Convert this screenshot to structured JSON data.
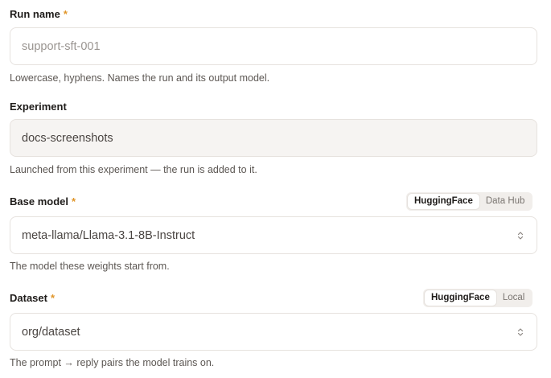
{
  "run_name": {
    "label": "Run name",
    "required_mark": "*",
    "placeholder": "support-sft-001",
    "value": "",
    "help": "Lowercase, hyphens. Names the run and its output model."
  },
  "experiment": {
    "label": "Experiment",
    "value": "docs-screenshots",
    "help": "Launched from this experiment — the run is added to it."
  },
  "base_model": {
    "label": "Base model",
    "required_mark": "*",
    "value": "meta-llama/Llama-3.1-8B-Instruct",
    "help": "The model these weights start from.",
    "sources": [
      "HuggingFace",
      "Data Hub"
    ],
    "selected_source": "HuggingFace"
  },
  "dataset": {
    "label": "Dataset",
    "required_mark": "*",
    "value": "org/dataset",
    "help": "The prompt → reply pairs the model trains on.",
    "sources": [
      "HuggingFace",
      "Local"
    ],
    "selected_source": "HuggingFace"
  },
  "colors": {
    "required": "#e0962a",
    "border": "#e6e2de",
    "readonly_bg": "#f6f4f2"
  }
}
